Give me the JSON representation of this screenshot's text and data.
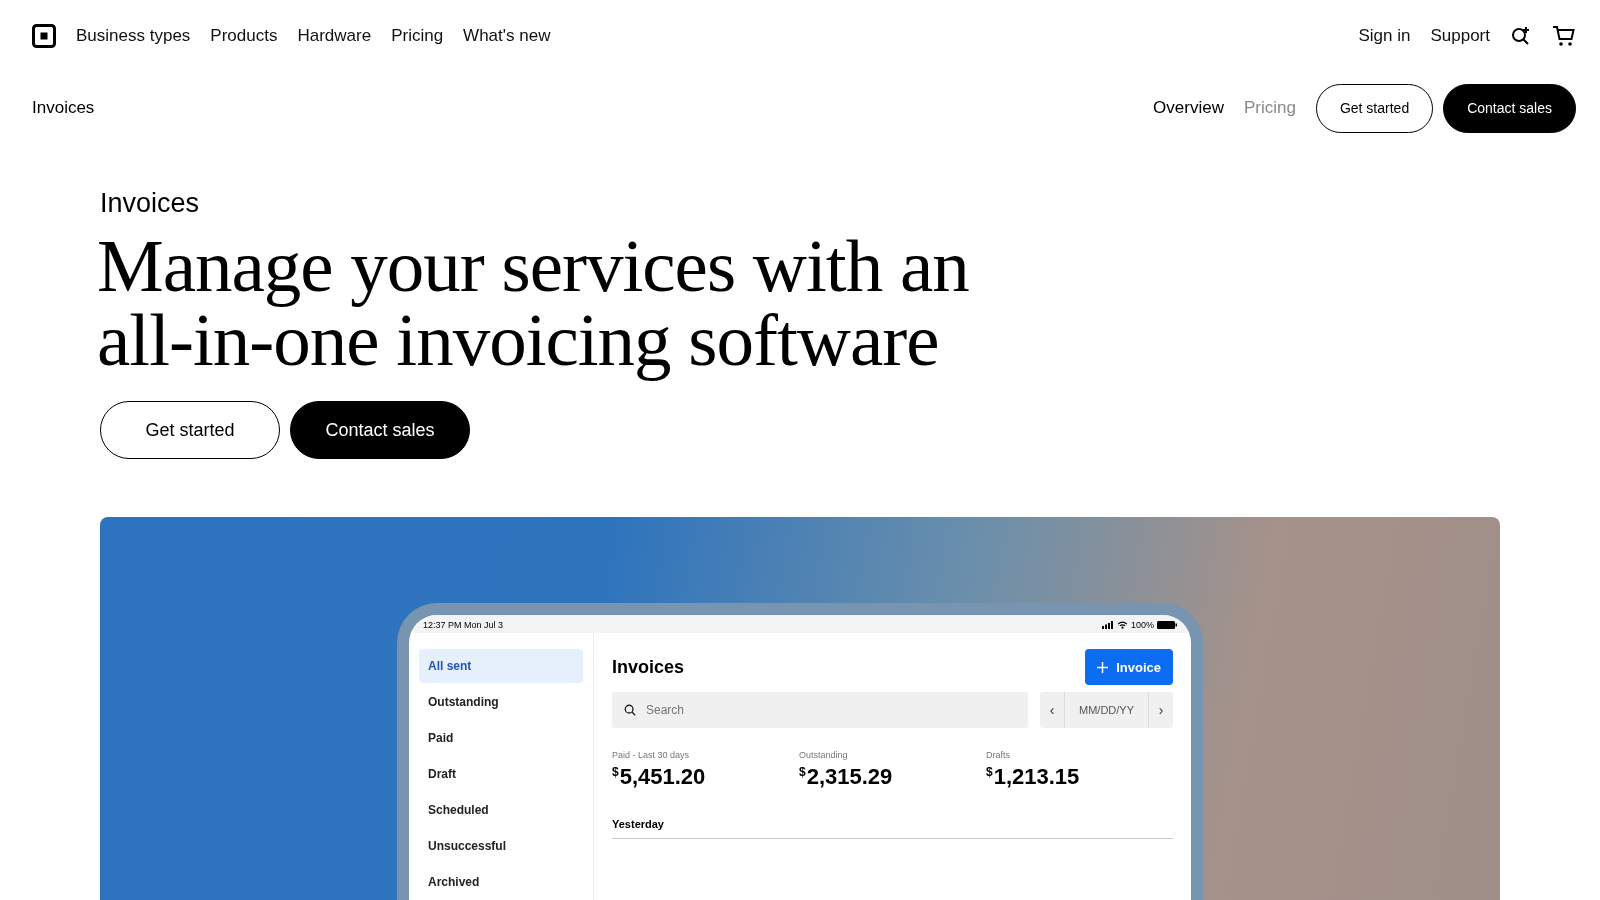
{
  "top_nav": {
    "items": [
      {
        "label": "Business types"
      },
      {
        "label": "Products"
      },
      {
        "label": "Hardware"
      },
      {
        "label": "Pricing"
      },
      {
        "label": "What's new"
      }
    ],
    "right_links": [
      {
        "label": "Sign in"
      },
      {
        "label": "Support"
      }
    ]
  },
  "sub_nav": {
    "title": "Invoices",
    "tabs": [
      {
        "label": "Overview",
        "selected": true
      },
      {
        "label": "Pricing",
        "selected": false
      }
    ],
    "buttons": [
      {
        "label": "Get started",
        "kind": "outline"
      },
      {
        "label": "Contact sales",
        "kind": "solid"
      }
    ]
  },
  "hero": {
    "eyebrow": "Invoices",
    "headline": "Manage your services with an all-in-one invoicing software",
    "buttons": [
      {
        "label": "Get started",
        "kind": "outline"
      },
      {
        "label": "Contact sales",
        "kind": "solid"
      }
    ]
  },
  "device": {
    "status_bar": {
      "time": "12:37 PM  Mon Jul 3",
      "battery": "100%"
    },
    "sidebar": [
      {
        "label": "All sent",
        "selected": true
      },
      {
        "label": "Outstanding",
        "selected": false
      },
      {
        "label": "Paid",
        "selected": false
      },
      {
        "label": "Draft",
        "selected": false
      },
      {
        "label": "Scheduled",
        "selected": false
      },
      {
        "label": "Unsuccessful",
        "selected": false
      },
      {
        "label": "Archived",
        "selected": false
      }
    ],
    "title": "Invoices",
    "new_button": "Invoice",
    "search": {
      "placeholder": "Search"
    },
    "date": {
      "prev": "‹",
      "value": "MM/DD/YY",
      "next": "›"
    },
    "stats": [
      {
        "label": "Paid - Last 30 days",
        "currency": "$",
        "amount": "5,451.20"
      },
      {
        "label": "Outstanding",
        "currency": "$",
        "amount": "2,315.29"
      },
      {
        "label": "Drafts",
        "currency": "$",
        "amount": "1,213.15"
      }
    ],
    "section": "Yesterday"
  }
}
